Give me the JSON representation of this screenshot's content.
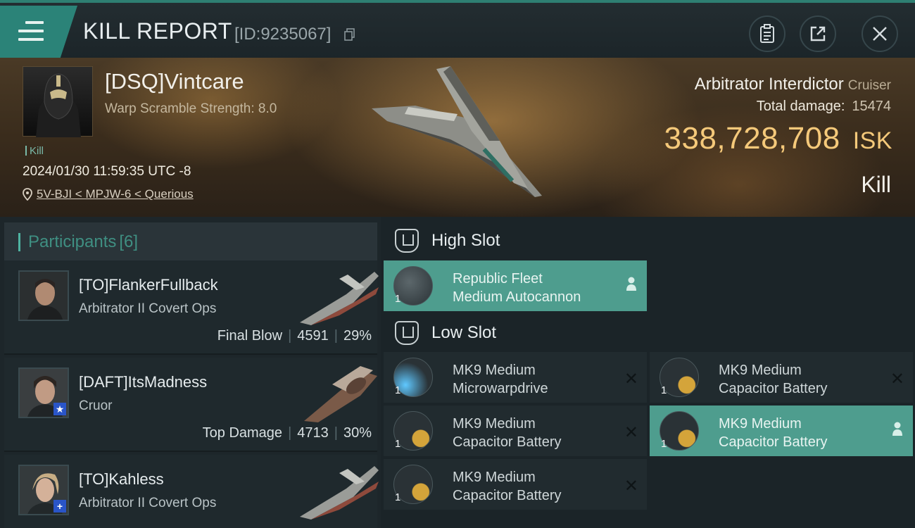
{
  "header": {
    "title": "KILL REPORT",
    "report_id": "[ID:9235067]"
  },
  "victim": {
    "pilot": "[DSQ]Vintcare",
    "warp_scramble": "Warp Scramble Strength: 8.0",
    "tag": "Kill",
    "datetime": "2024/01/30 11:59:35 UTC -8",
    "location": "5V-BJI < MPJW-6 < Querious",
    "ship_name": "Arbitrator Interdictor",
    "ship_class": "Cruiser",
    "total_damage_label": "Total damage:",
    "total_damage_value": "15474",
    "isk_value": "338,728,708",
    "isk_unit": "ISK",
    "result": "Kill"
  },
  "participants": {
    "label": "Participants",
    "count": "[6]",
    "rows": [
      {
        "name": "[TO]FlankerFullback",
        "ship": "Arbitrator II Covert Ops",
        "role": "Final Blow",
        "damage": "4591",
        "percent": "29%"
      },
      {
        "name": "[DAFT]ItsMadness",
        "ship": "Cruor",
        "role": "Top Damage",
        "damage": "4713",
        "percent": "30%"
      },
      {
        "name": "[TO]Kahless",
        "ship": "Arbitrator II Covert Ops",
        "role": "",
        "damage": "",
        "percent": ""
      }
    ]
  },
  "fittings": {
    "high_slot_label": "High Slot",
    "low_slot_label": "Low Slot",
    "high": [
      {
        "qty": "1",
        "line1": "Republic Fleet",
        "line2": "Medium Autocannon",
        "state": "dropped"
      }
    ],
    "low": [
      {
        "qty": "1",
        "line1": "MK9 Medium",
        "line2": "Microwarpdrive",
        "state": "destroyed"
      },
      {
        "qty": "1",
        "line1": "MK9 Medium",
        "line2": "Capacitor Battery",
        "state": "destroyed"
      },
      {
        "qty": "1",
        "line1": "MK9 Medium",
        "line2": "Capacitor Battery",
        "state": "destroyed"
      },
      {
        "qty": "1",
        "line1": "MK9 Medium",
        "line2": "Capacitor Battery",
        "state": "dropped"
      },
      {
        "qty": "1",
        "line1": "MK9 Medium",
        "line2": "Capacitor Battery",
        "state": "destroyed"
      }
    ],
    "destroyed_symbol": "✕"
  },
  "icons": {
    "menu": "hamburger-icon",
    "copy": "copy-icon",
    "clipboard": "clipboard-icon",
    "share": "share-icon",
    "close": "close-icon",
    "location": "location-pin-icon",
    "slot": "slot-icon",
    "owner": "person-icon"
  },
  "colors": {
    "accent": "#2b8378",
    "isk": "#f5c97a",
    "highlight_row": "#4e9d8e"
  }
}
